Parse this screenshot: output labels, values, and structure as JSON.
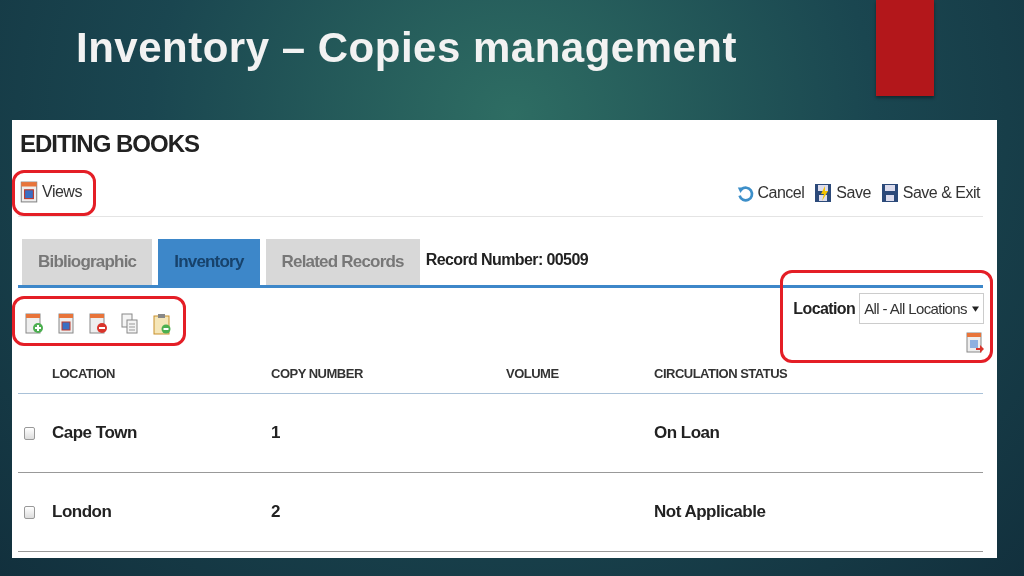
{
  "slide": {
    "title": "Inventory – Copies management"
  },
  "page": {
    "heading": "EDITING BOOKS"
  },
  "views": {
    "label": "Views",
    "highlighted": true
  },
  "actions": [
    {
      "kind": "cancel",
      "label": "Cancel"
    },
    {
      "kind": "save",
      "label": "Save"
    },
    {
      "kind": "save_exit",
      "label": "Save & Exit"
    }
  ],
  "tabs": [
    {
      "label": "Bibliographic",
      "selected": false
    },
    {
      "label": "Inventory",
      "selected": true
    },
    {
      "label": "Related Records",
      "selected": false
    }
  ],
  "record_number": "Record Number: 00509",
  "toolbar": {
    "highlighted": true,
    "items": [
      {
        "kind": "add"
      },
      {
        "kind": "view"
      },
      {
        "kind": "remove"
      },
      {
        "kind": "copy"
      },
      {
        "kind": "paste"
      }
    ]
  },
  "location_filter": {
    "label": "Location",
    "value": "All - All Locations",
    "highlighted": true
  },
  "table": {
    "columns": [
      "LOCATION",
      "COPY NUMBER",
      "VOLUME",
      "CIRCULATION STATUS"
    ],
    "rows": [
      {
        "checked": false,
        "cells": [
          "Cape Town",
          "1",
          "",
          "On Loan"
        ]
      },
      {
        "checked": false,
        "cells": [
          "London",
          "2",
          "",
          "Not Applicable"
        ]
      }
    ]
  }
}
